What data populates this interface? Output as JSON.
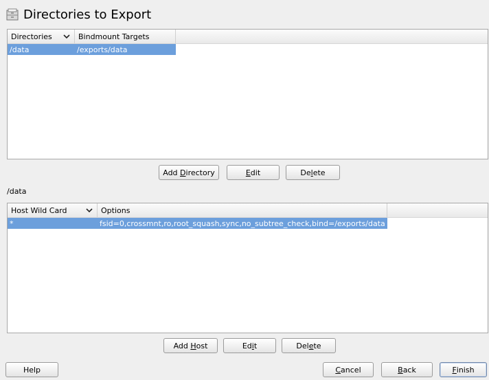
{
  "page": {
    "title": "Directories to Export"
  },
  "directories_table": {
    "columns": [
      "Directories",
      "Bindmount Targets"
    ],
    "rows": [
      {
        "directory": "/data",
        "target": "/exports/data"
      }
    ]
  },
  "dir_buttons": {
    "add": {
      "pre": "Add ",
      "key": "D",
      "post": "irectory"
    },
    "edit": {
      "pre": "",
      "key": "E",
      "post": "dit"
    },
    "delete": {
      "pre": "De",
      "key": "l",
      "post": "ete"
    }
  },
  "selected_path": "/data",
  "hosts_table": {
    "columns": [
      "Host Wild Card",
      "Options"
    ],
    "rows": [
      {
        "host": "*",
        "options": "fsid=0,crossmnt,ro,root_squash,sync,no_subtree_check,bind=/exports/data"
      }
    ]
  },
  "host_buttons": {
    "add": {
      "pre": "Add ",
      "key": "H",
      "post": "ost"
    },
    "edit": {
      "pre": "Ed",
      "key": "i",
      "post": "t"
    },
    "delete": {
      "pre": "Del",
      "key": "e",
      "post": "te"
    }
  },
  "footer": {
    "help": "Help",
    "cancel": {
      "pre": "",
      "key": "C",
      "post": "ancel"
    },
    "back": {
      "pre": "",
      "key": "B",
      "post": "ack"
    },
    "finish": {
      "pre": "",
      "key": "F",
      "post": "inish"
    }
  }
}
